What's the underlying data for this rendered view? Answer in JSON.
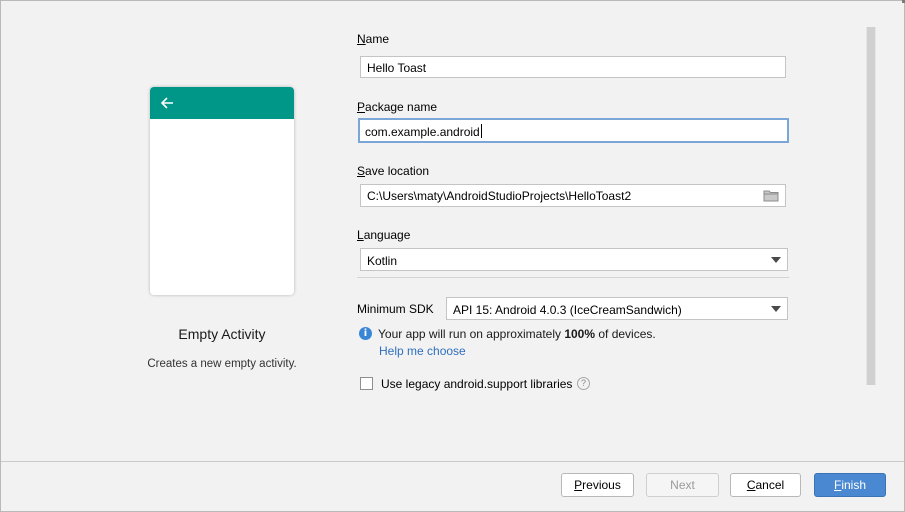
{
  "template": {
    "title": "Empty Activity",
    "description": "Creates a new empty activity."
  },
  "form": {
    "name": {
      "label_mnemonic": "N",
      "label_rest": "ame",
      "value": "Hello Toast"
    },
    "package": {
      "label_mnemonic": "P",
      "label_rest": "ackage name",
      "value": "com.example.android"
    },
    "save_location": {
      "label_mnemonic": "S",
      "label_rest": "ave location",
      "value": "C:\\Users\\maty\\AndroidStudioProjects\\HelloToast2"
    },
    "language": {
      "label_mnemonic": "L",
      "label_rest": "anguage",
      "value": "Kotlin"
    },
    "min_sdk": {
      "label": "Minimum SDK",
      "value": "API 15: Android 4.0.3 (IceCreamSandwich)"
    },
    "info": {
      "prefix": "Your app will run on approximately ",
      "percent": "100%",
      "suffix": " of devices."
    },
    "help_link": "Help me choose",
    "legacy_checkbox": {
      "label": "Use legacy android.support libraries",
      "checked": false
    }
  },
  "buttons": {
    "previous": {
      "mnemonic": "P",
      "rest": "revious"
    },
    "next": "Next",
    "cancel": {
      "mnemonic": "C",
      "rest": "ancel"
    },
    "finish": {
      "mnemonic": "F",
      "rest": "inish"
    }
  },
  "colors": {
    "toolbar": "#009688",
    "accent": "#4a88d2",
    "link": "#2f6fbf"
  }
}
